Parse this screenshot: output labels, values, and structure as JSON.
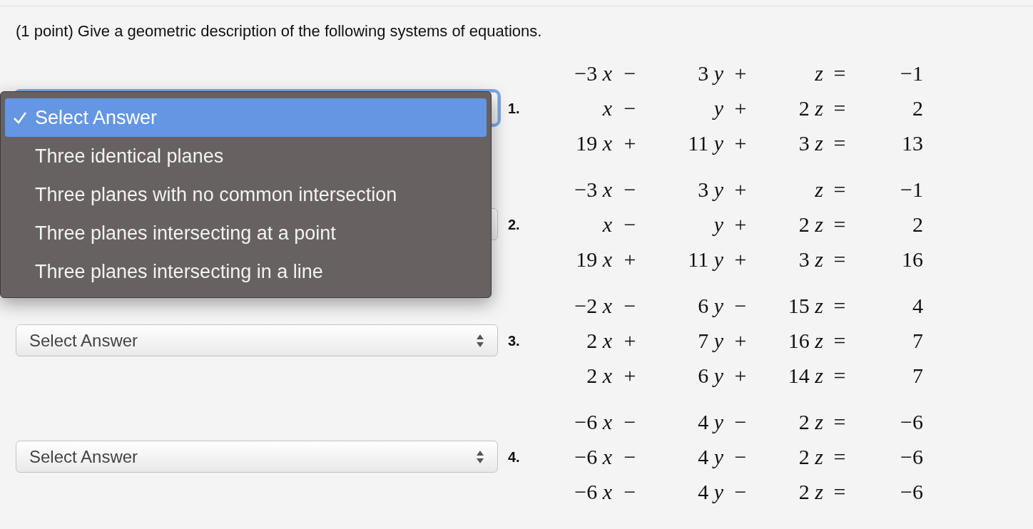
{
  "prompt": "(1 point) Give a geometric description of the following systems of equations.",
  "problems": [
    {
      "number": "1.",
      "select": {
        "focused": true
      },
      "rows": [
        {
          "terms": [
            {
              "coef": "−3",
              "var": "x"
            },
            {
              "coef": "3",
              "var": "y"
            },
            {
              "var": "z"
            }
          ],
          "ops": [
            "−",
            "+"
          ],
          "eq": "=",
          "rhs": "−1"
        },
        {
          "terms": [
            {
              "var": "x"
            },
            {
              "var": "y"
            },
            {
              "coef": "2",
              "var": "z"
            }
          ],
          "ops": [
            "−",
            "+"
          ],
          "eq": "=",
          "rhs": "2"
        },
        {
          "terms": [
            {
              "coef": "19",
              "var": "x"
            },
            {
              "coef": "11",
              "var": "y"
            },
            {
              "coef": "3",
              "var": "z"
            }
          ],
          "ops": [
            "+",
            "+"
          ],
          "eq": "=",
          "rhs": "13"
        }
      ]
    },
    {
      "number": "2.",
      "select": {
        "focused": false
      },
      "rows": [
        {
          "terms": [
            {
              "coef": "−3",
              "var": "x"
            },
            {
              "coef": "3",
              "var": "y"
            },
            {
              "var": "z"
            }
          ],
          "ops": [
            "−",
            "+"
          ],
          "eq": "=",
          "rhs": "−1"
        },
        {
          "terms": [
            {
              "var": "x"
            },
            {
              "var": "y"
            },
            {
              "coef": "2",
              "var": "z"
            }
          ],
          "ops": [
            "−",
            "+"
          ],
          "eq": "=",
          "rhs": "2"
        },
        {
          "terms": [
            {
              "coef": "19",
              "var": "x"
            },
            {
              "coef": "11",
              "var": "y"
            },
            {
              "coef": "3",
              "var": "z"
            }
          ],
          "ops": [
            "+",
            "+"
          ],
          "eq": "=",
          "rhs": "16"
        }
      ]
    },
    {
      "number": "3.",
      "select": {
        "focused": false,
        "value": "Select Answer"
      },
      "rows": [
        {
          "terms": [
            {
              "coef": "−2",
              "var": "x"
            },
            {
              "coef": "6",
              "var": "y"
            },
            {
              "coef": "15",
              "var": "z"
            }
          ],
          "ops": [
            "−",
            "−"
          ],
          "eq": "=",
          "rhs": "4"
        },
        {
          "terms": [
            {
              "coef": "2",
              "var": "x"
            },
            {
              "coef": "7",
              "var": "y"
            },
            {
              "coef": "16",
              "var": "z"
            }
          ],
          "ops": [
            "+",
            "+"
          ],
          "eq": "=",
          "rhs": "7"
        },
        {
          "terms": [
            {
              "coef": "2",
              "var": "x"
            },
            {
              "coef": "6",
              "var": "y"
            },
            {
              "coef": "14",
              "var": "z"
            }
          ],
          "ops": [
            "+",
            "+"
          ],
          "eq": "=",
          "rhs": "7"
        }
      ]
    },
    {
      "number": "4.",
      "select": {
        "focused": false,
        "value": "Select Answer"
      },
      "rows": [
        {
          "terms": [
            {
              "coef": "−6",
              "var": "x"
            },
            {
              "coef": "4",
              "var": "y"
            },
            {
              "coef": "2",
              "var": "z"
            }
          ],
          "ops": [
            "−",
            "−"
          ],
          "eq": "=",
          "rhs": "−6"
        },
        {
          "terms": [
            {
              "coef": "−6",
              "var": "x"
            },
            {
              "coef": "4",
              "var": "y"
            },
            {
              "coef": "2",
              "var": "z"
            }
          ],
          "ops": [
            "−",
            "−"
          ],
          "eq": "=",
          "rhs": "−6"
        },
        {
          "terms": [
            {
              "coef": "−6",
              "var": "x"
            },
            {
              "coef": "4",
              "var": "y"
            },
            {
              "coef": "2",
              "var": "z"
            }
          ],
          "ops": [
            "−",
            "−"
          ],
          "eq": "=",
          "rhs": "−6"
        }
      ]
    }
  ],
  "dropdown_menu": {
    "options": [
      {
        "label": "Select Answer",
        "selected": true
      },
      {
        "label": "Three identical planes",
        "selected": false
      },
      {
        "label": "Three planes with no common intersection",
        "selected": false
      },
      {
        "label": "Three planes intersecting at a point",
        "selected": false
      },
      {
        "label": "Three planes intersecting in a line",
        "selected": false
      }
    ]
  }
}
